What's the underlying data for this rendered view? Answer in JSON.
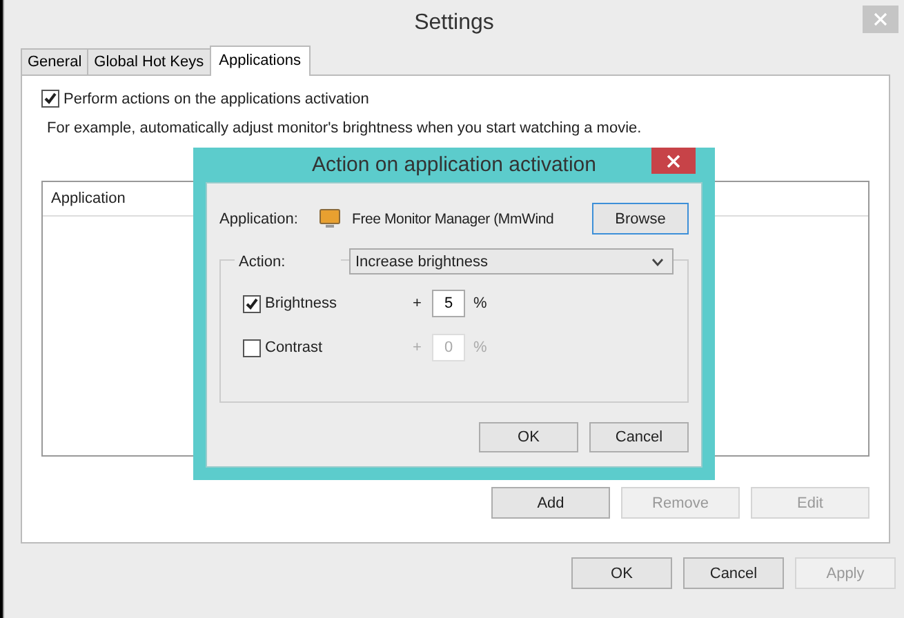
{
  "window": {
    "title": "Settings"
  },
  "tabs": [
    {
      "label": "General",
      "selected": false
    },
    {
      "label": "Global Hot Keys",
      "selected": false
    },
    {
      "label": "Applications",
      "selected": true
    }
  ],
  "perform_actions": {
    "label": "Perform actions on the applications activation",
    "checked": true
  },
  "hint": "For example, automatically adjust monitor's brightness when you start watching a movie.",
  "table": {
    "columns": [
      "Application"
    ]
  },
  "list_buttons": [
    {
      "label": "Add",
      "disabled": false
    },
    {
      "label": "Remove",
      "disabled": true
    },
    {
      "label": "Edit",
      "disabled": true
    }
  ],
  "buttons": [
    {
      "label": "OK",
      "disabled": false
    },
    {
      "label": "Cancel",
      "disabled": false
    },
    {
      "label": "Apply",
      "disabled": true
    }
  ],
  "dialog": {
    "title": "Action on application activation",
    "application_label": "Application:",
    "application": "Free Monitor Manager (MmWind",
    "browse": "Browse",
    "action_label": "Action:",
    "action": "Increase brightness",
    "settings": [
      {
        "label": "Brightness",
        "checked": true,
        "sign": "+",
        "value": "5",
        "unit": "%",
        "disabled": false
      },
      {
        "label": "Contrast",
        "checked": false,
        "sign": "+",
        "value": "0",
        "unit": "%",
        "disabled": true
      }
    ],
    "buttons": [
      "OK",
      "Cancel"
    ]
  }
}
